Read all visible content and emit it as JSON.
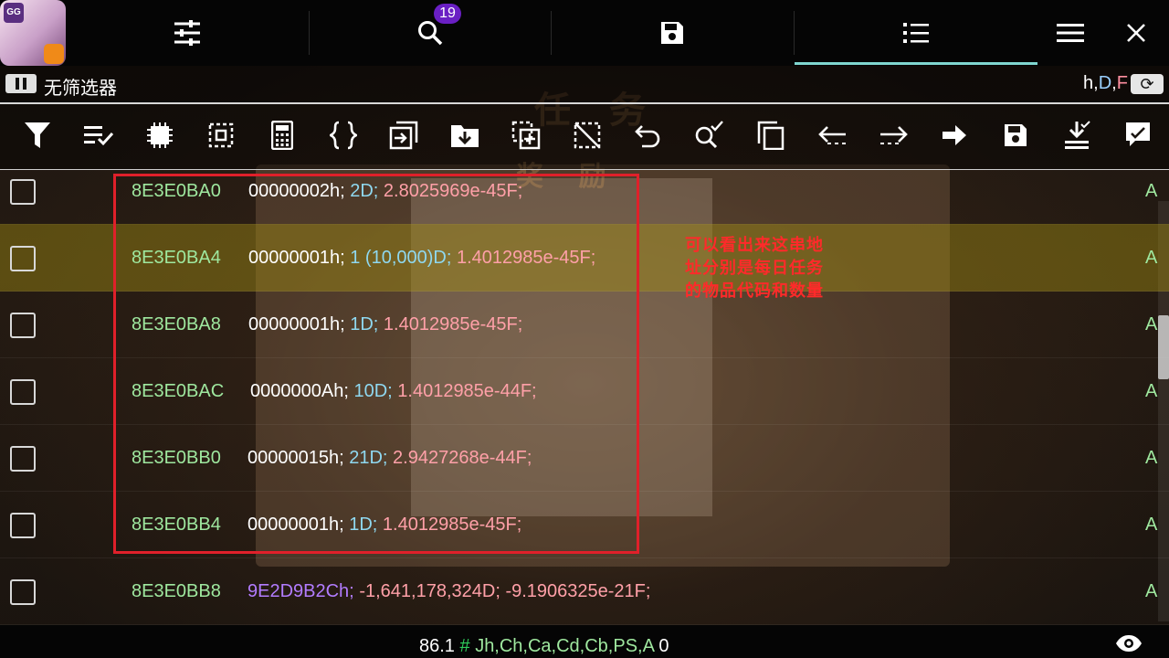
{
  "tabs": {
    "search_badge": "19"
  },
  "status": {
    "filter_label": "无筛选器",
    "types_h": "h",
    "types_d": "D",
    "types_f": "F",
    "types_sep": ","
  },
  "toolbar_icons": [
    "filter-icon",
    "select-checklist-icon",
    "chip-icon",
    "select-region-icon",
    "calculator-icon",
    "braces-icon",
    "copy-out-icon",
    "folder-download-icon",
    "select-copy-icon",
    "deselect-icon",
    "undo-icon",
    "search-check-icon",
    "duplicate-icon",
    "arrow-left-icon",
    "arrow-right-wrap-icon",
    "arrow-right-solid-icon",
    "save-icon",
    "download-check-icon",
    "edit-chat-icon"
  ],
  "rows": [
    {
      "addr": "8E3E0BA0",
      "hex": "00000002h;",
      "dec": "2D;",
      "flt": "2.8025969e-45F;",
      "flag": "A"
    },
    {
      "addr": "8E3E0BA4",
      "hex": "00000001h;",
      "dec": "1 (10,000)D;",
      "flt": "1.4012985e-45F;",
      "flag": "A"
    },
    {
      "addr": "8E3E0BA8",
      "hex": "00000001h;",
      "dec": "1D;",
      "flt": "1.4012985e-45F;",
      "flag": "A"
    },
    {
      "addr": "8E3E0BAC",
      "hex": "0000000Ah;",
      "dec": "10D;",
      "flt": "1.4012985e-44F;",
      "flag": "A"
    },
    {
      "addr": "8E3E0BB0",
      "hex": "00000015h;",
      "dec": "21D;",
      "flt": "2.9427268e-44F;",
      "flag": "A"
    },
    {
      "addr": "8E3E0BB4",
      "hex": "00000001h;",
      "dec": "1D;",
      "flt": "1.4012985e-45F;",
      "flag": "A"
    },
    {
      "addr": "8E3E0BB8",
      "hex": "9E2D9B2Ch;",
      "dec": "-1,641,178,324D;",
      "flt": "-9.1906325e-21F;",
      "flag": "A"
    }
  ],
  "annotation": {
    "line1": "可以看出来这串地",
    "line2": "址分别是每日任务",
    "line3": "的物品代码和数量"
  },
  "background": {
    "title": "任 务",
    "subtitle": "奖 励"
  },
  "footer": {
    "value": "86.1",
    "hash": "#",
    "regions": "Jh,Ch,Ca,Cd,Cb,PS,A",
    "count": "0"
  },
  "colors": {
    "address": "#9fe89f",
    "decimal": "#8fd8f0",
    "float": "#ffa0a8",
    "hex_purple": "#b27cff",
    "highlight": "#a08c14",
    "tab_underline": "#7fd6cf",
    "box": "#e0202a",
    "badge": "#6a1fc4"
  }
}
